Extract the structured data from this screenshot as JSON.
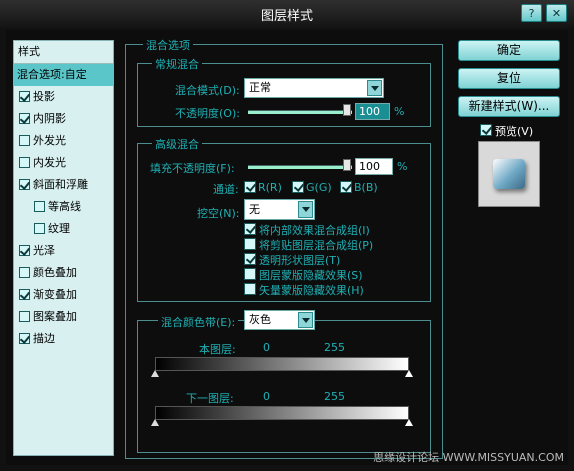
{
  "window": {
    "title": "图层样式"
  },
  "left_panel": {
    "header": "样式",
    "items": [
      {
        "label": "混合选项:自定",
        "selected": true
      },
      {
        "label": "投影",
        "checked": true
      },
      {
        "label": "内阴影",
        "checked": true
      },
      {
        "label": "外发光",
        "checked": false
      },
      {
        "label": "内发光",
        "checked": false
      },
      {
        "label": "斜面和浮雕",
        "checked": true
      },
      {
        "label": "等高线",
        "checked": false,
        "indent": true
      },
      {
        "label": "纹理",
        "checked": false,
        "indent": true
      },
      {
        "label": "光泽",
        "checked": true
      },
      {
        "label": "颜色叠加",
        "checked": false
      },
      {
        "label": "渐变叠加",
        "checked": true
      },
      {
        "label": "图案叠加",
        "checked": false
      },
      {
        "label": "描边",
        "checked": true
      }
    ]
  },
  "blend_options": {
    "title": "混合选项",
    "general": {
      "title": "常规混合",
      "mode_label": "混合模式(D):",
      "mode_value": "正常",
      "opacity_label": "不透明度(O):",
      "opacity_value": "100",
      "percent": "%"
    },
    "advanced": {
      "title": "高级混合",
      "fill_label": "填充不透明度(F):",
      "fill_value": "100",
      "percent": "%",
      "channels_label": "通道:",
      "channels": [
        {
          "label": "R(R)",
          "checked": true
        },
        {
          "label": "G(G)",
          "checked": true
        },
        {
          "label": "B(B)",
          "checked": true
        }
      ],
      "knockout_label": "挖空(N):",
      "knockout_value": "无",
      "options": [
        {
          "label": "将内部效果混合成组(I)",
          "checked": true
        },
        {
          "label": "将剪贴图层混合成组(P)",
          "checked": false
        },
        {
          "label": "透明形状图层(T)",
          "checked": true
        },
        {
          "label": "图层蒙版隐藏效果(S)",
          "checked": false
        },
        {
          "label": "矢量蒙版隐藏效果(H)",
          "checked": false
        }
      ]
    },
    "blend_if": {
      "label": "混合颜色带(E):",
      "value": "灰色",
      "this_layer": {
        "label": "本图层:",
        "low": "0",
        "high": "255"
      },
      "underlying_layer": {
        "label": "下一图层:",
        "low": "0",
        "high": "255"
      }
    }
  },
  "buttons": {
    "ok": "确定",
    "reset": "复位",
    "new_style": "新建样式(W)...",
    "preview_label": "预览(V)",
    "preview_checked": true
  },
  "watermark": "思缘设计论坛  WWW.MISSYUAN.COM"
}
